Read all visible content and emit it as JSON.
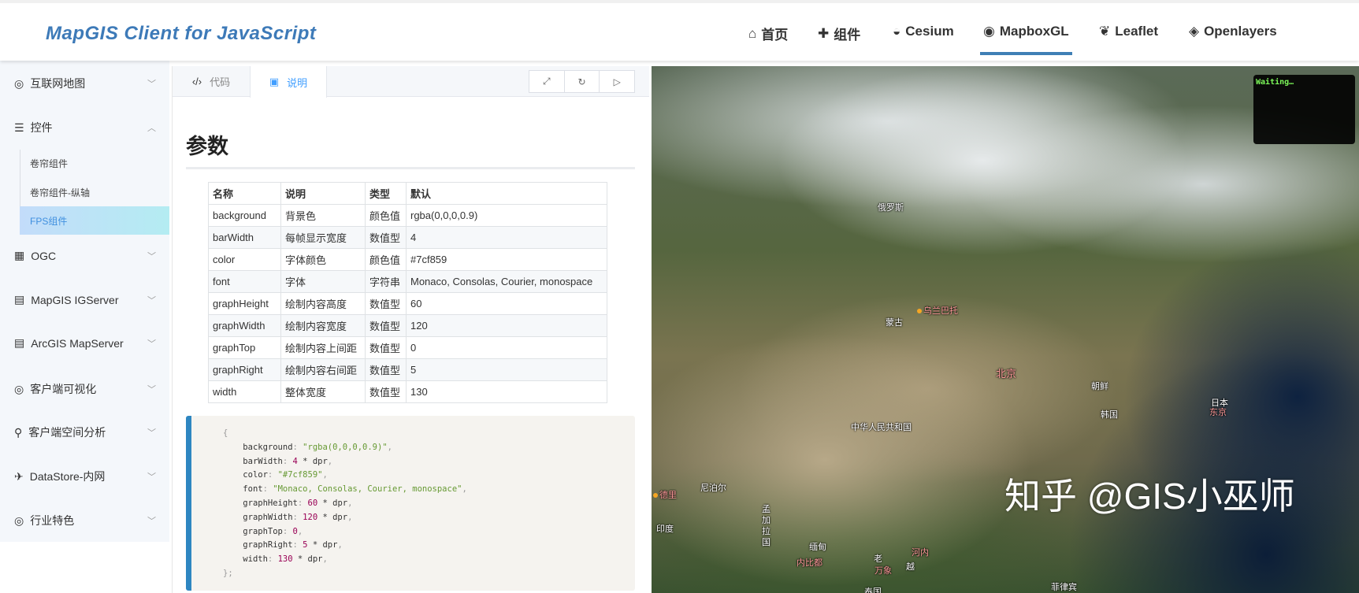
{
  "header": {
    "logo": "MapGIS Client for JavaScript",
    "nav": [
      {
        "label": "首页",
        "icon": "home-icon"
      },
      {
        "label": "组件",
        "icon": "puzzle-icon"
      },
      {
        "label": "Cesium",
        "icon": "cesium-icon"
      },
      {
        "label": "MapboxGL",
        "icon": "mapbox-icon",
        "active": true
      },
      {
        "label": "Leaflet",
        "icon": "leaf-icon"
      },
      {
        "label": "Openlayers",
        "icon": "layers-icon"
      }
    ]
  },
  "sidebar": {
    "items": [
      {
        "label": "互联网地图"
      },
      {
        "label": "控件"
      },
      {
        "label": "OGC"
      },
      {
        "label": "MapGIS IGServer"
      },
      {
        "label": "ArcGIS MapServer"
      },
      {
        "label": "客户端可视化"
      },
      {
        "label": "客户端空间分析"
      },
      {
        "label": "DataStore-内网"
      },
      {
        "label": "行业特色"
      }
    ],
    "subitems": [
      {
        "label": "卷帘组件"
      },
      {
        "label": "卷帘组件-纵轴"
      },
      {
        "label": "FPS组件",
        "active": true
      }
    ]
  },
  "panel": {
    "tabs": [
      {
        "label": "代码"
      },
      {
        "label": "说明",
        "active": true
      }
    ],
    "title": "参数",
    "table": {
      "headers": [
        "名称",
        "说明",
        "类型",
        "默认"
      ],
      "rows": [
        [
          "background",
          "背景色",
          "颜色值",
          "rgba(0,0,0,0.9)"
        ],
        [
          "barWidth",
          "每帧显示宽度",
          "数值型",
          "4"
        ],
        [
          "color",
          "字体颜色",
          "颜色值",
          "#7cf859"
        ],
        [
          "font",
          "字体",
          "字符串",
          "Monaco, Consolas, Courier, monospace"
        ],
        [
          "graphHeight",
          "绘制内容高度",
          "数值型",
          "60"
        ],
        [
          "graphWidth",
          "绘制内容宽度",
          "数值型",
          "120"
        ],
        [
          "graphTop",
          "绘制内容上间距",
          "数值型",
          "0"
        ],
        [
          "graphRight",
          "绘制内容右间距",
          "数值型",
          "5"
        ],
        [
          "width",
          "整体宽度",
          "数值型",
          "130"
        ]
      ]
    },
    "code": [
      [
        "background",
        ":",
        "\"rgba(0,0,0,0.9)\"",
        ""
      ],
      [
        "barWidth",
        ":",
        "4",
        " * dpr"
      ],
      [
        "color",
        ":",
        "\"#7cf859\"",
        ""
      ],
      [
        "font",
        ":",
        "\"Monaco, Consolas, Courier, monospace\"",
        ""
      ],
      [
        "graphHeight",
        ":",
        "60",
        " * dpr"
      ],
      [
        "graphWidth",
        ":",
        "120",
        " * dpr"
      ],
      [
        "graphTop",
        ":",
        "0",
        ""
      ],
      [
        "graphRight",
        ":",
        "5",
        " * dpr"
      ],
      [
        "width",
        ":",
        "130",
        " * dpr"
      ]
    ],
    "code_open": "{",
    "code_close": "};"
  },
  "map": {
    "fps_text": "Waiting…",
    "watermark": "知乎 @GIS小巫师",
    "labels": [
      "俄罗斯",
      "乌兰巴托",
      "蒙古",
      "北京",
      "朝鲜",
      "韩国",
      "日本",
      "东京",
      "中华人民共和国",
      "尼泊尔",
      "德里",
      "印度",
      "孟加拉国",
      "缅甸",
      "内比都",
      "老",
      "河内",
      "万象",
      "越",
      "泰国",
      "菲律宾"
    ]
  },
  "colors": {
    "accent": "#3f7fb5",
    "fps_green": "#7cf859",
    "code_border": "#2e86c1"
  }
}
